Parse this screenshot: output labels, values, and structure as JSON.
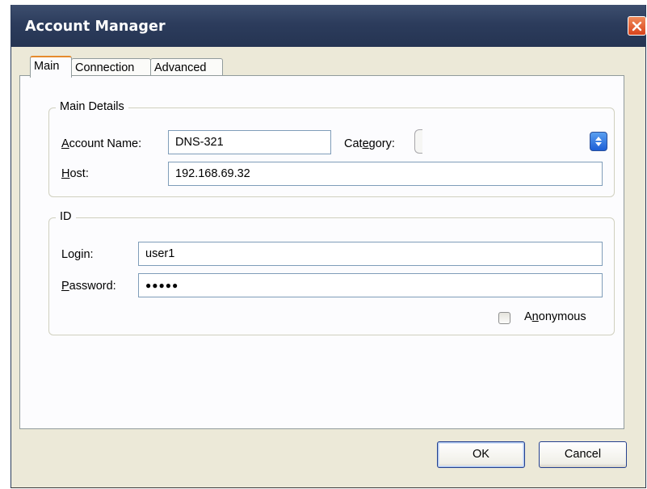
{
  "window": {
    "title": "Account Manager",
    "close_icon": "close-icon"
  },
  "tabs": [
    {
      "label": "Main",
      "active": true
    },
    {
      "label": "Connection",
      "active": false
    },
    {
      "label": "Advanced",
      "active": false
    }
  ],
  "main_details": {
    "legend": "Main Details",
    "account_name_label_pre": "",
    "account_name_label_ul": "A",
    "account_name_label_post": "ccount Name:",
    "account_name_value": "DNS-321",
    "category_label_pre": "Cat",
    "category_label_ul": "e",
    "category_label_post": "gory:",
    "category_value": "",
    "host_label_ul": "H",
    "host_label_post": "ost:",
    "host_value": "192.168.69.32"
  },
  "id_group": {
    "legend": "ID",
    "login_label_pre": "Lo",
    "login_label_ul": "g",
    "login_label_post": "in:",
    "login_value": "user1",
    "password_label_ul": "P",
    "password_label_post": "assword:",
    "password_value": "●●●●●",
    "anonymous_label_pre": "A",
    "anonymous_label_ul": "n",
    "anonymous_label_post": "onymous",
    "anonymous_checked": false
  },
  "buttons": {
    "ok": "OK",
    "cancel": "Cancel"
  },
  "colors": {
    "titlebar": "#2c3c5c",
    "close": "#d9431b",
    "active_tab_accent": "#e68b2c",
    "dialog_bg": "#ece9d8"
  }
}
